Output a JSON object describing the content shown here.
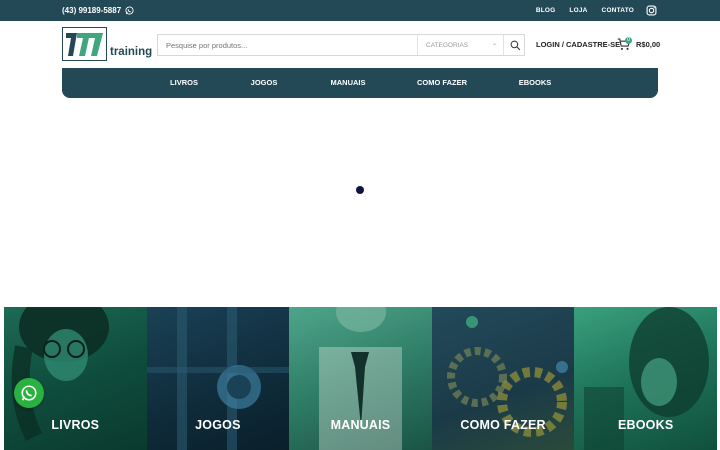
{
  "topbar": {
    "phone": "(43) 99189-5887",
    "links": [
      "BLOG",
      "LOJA",
      "CONTATO"
    ]
  },
  "logo": {
    "text": "training"
  },
  "search": {
    "placeholder": "Pesquise por produtos...",
    "category": "CATEGORIAS"
  },
  "account": {
    "login": "LOGIN / CADASTRE-SE"
  },
  "cart": {
    "count": "0",
    "total": "R$0,00"
  },
  "nav": {
    "items": [
      "LIVROS",
      "JOGOS",
      "MANUAIS",
      "COMO FAZER",
      "EBOOKS"
    ]
  },
  "tiles": [
    "LIVROS",
    "JOGOS",
    "MANUAIS",
    "COMO FAZER",
    "EBOOKS"
  ],
  "colors": {
    "brand": "#234856",
    "accent": "#3fa77f",
    "whatsapp": "#2ab140"
  }
}
